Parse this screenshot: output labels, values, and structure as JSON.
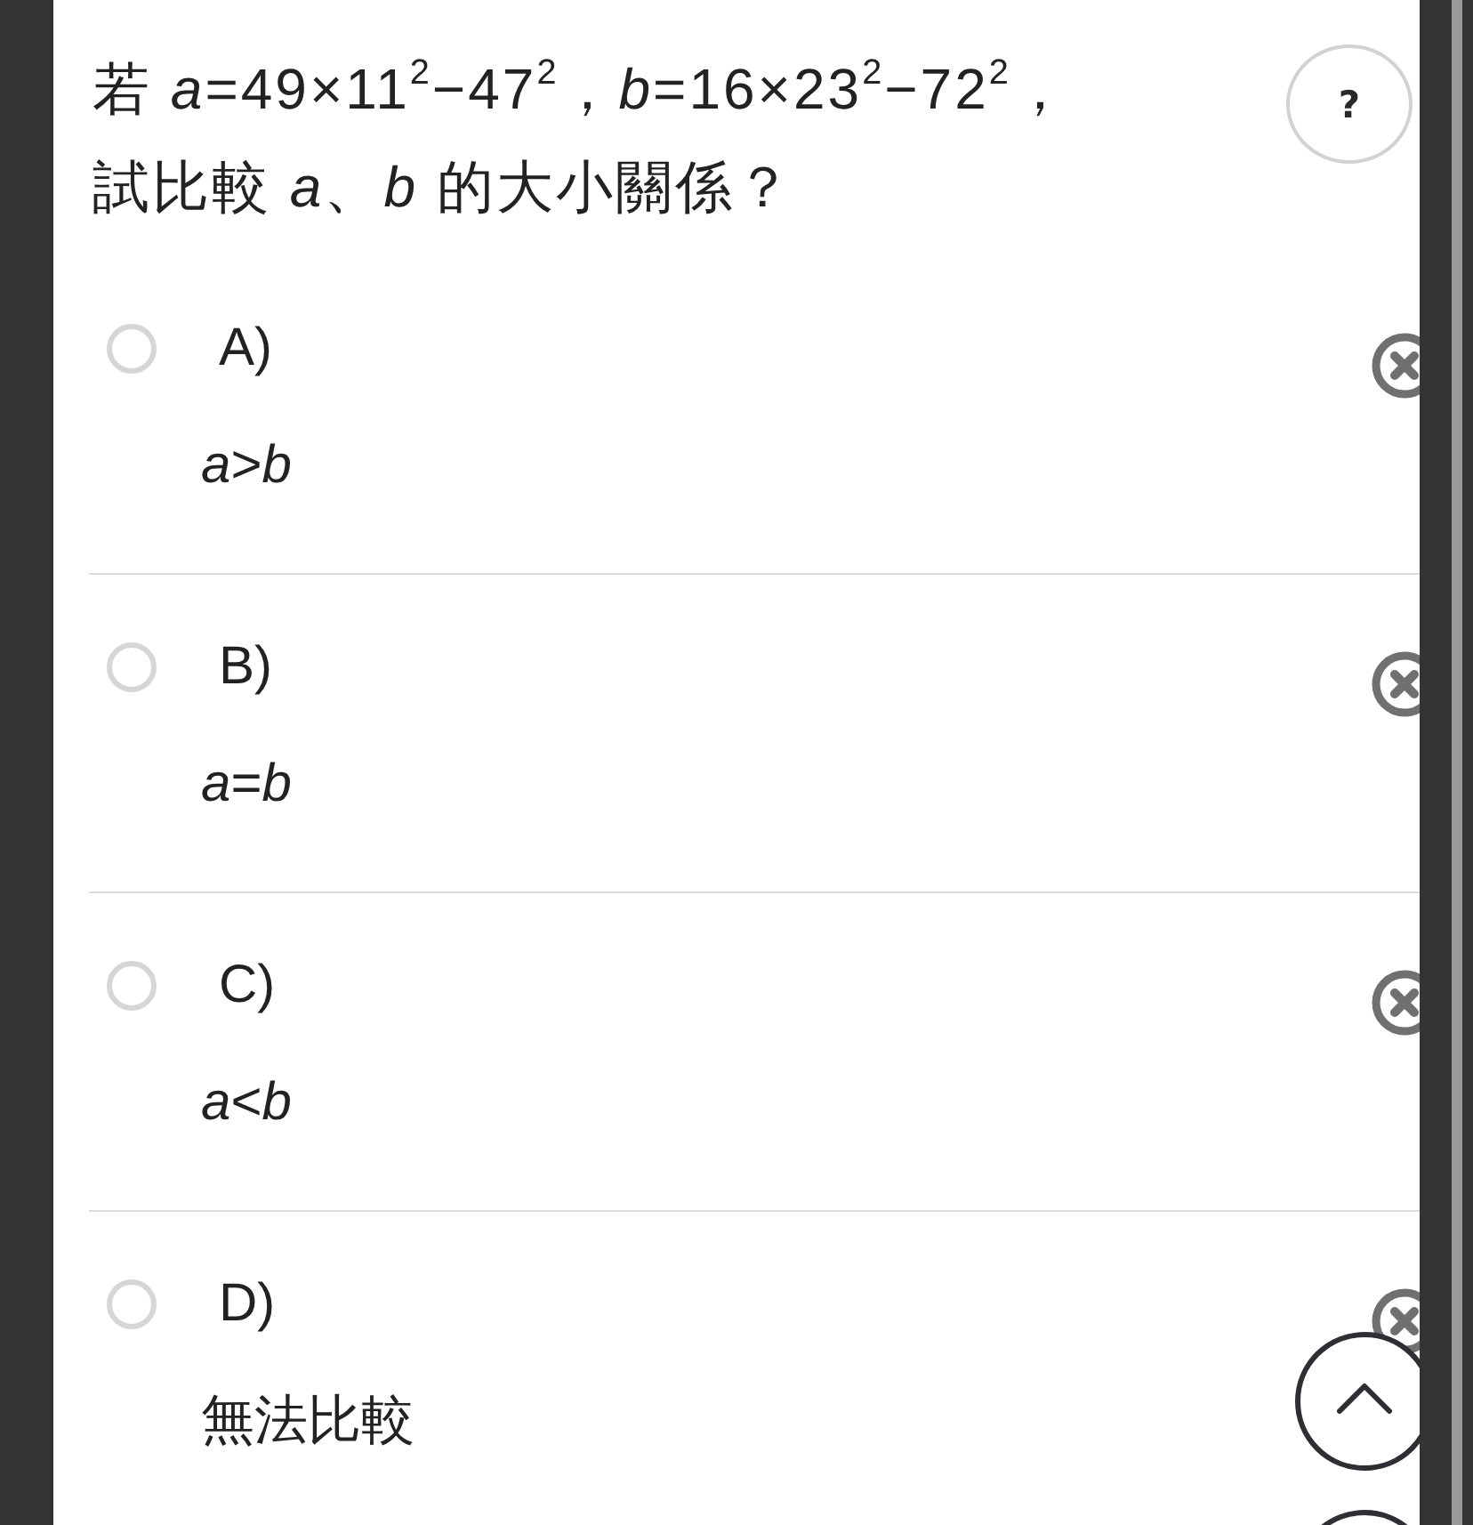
{
  "question": {
    "text": "若 *a*=49×11$^{2}$−47$^{2}$，*b*=16×23$^{2}$−72$^{2}$，試比較 *a*、*b* 的大小關係？"
  },
  "help_button": {
    "label": "?"
  },
  "options": [
    {
      "label": "A)",
      "answer": "*a*>*b*",
      "selected": false
    },
    {
      "label": "B)",
      "answer": "*a*=*b*",
      "selected": false
    },
    {
      "label": "C)",
      "answer": "*a*<*b*",
      "selected": false
    },
    {
      "label": "D)",
      "answer": "無法比較",
      "selected": false
    }
  ]
}
